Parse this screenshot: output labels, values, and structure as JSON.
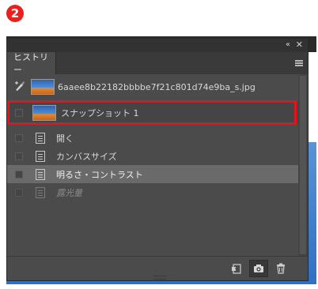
{
  "step_badge": "2",
  "panel": {
    "tab_label": "ヒストリー",
    "title_icons": {
      "collapse": "collapse-arrows-icon",
      "close": "close-icon",
      "menu": "panel-menu-icon"
    }
  },
  "history": {
    "source_image": "6aaee8b22182bbbbe7f21c801d74e9ba_s.jpg",
    "snapshot_label": "スナップショット 1",
    "states": [
      {
        "label": "開く",
        "state": "normal"
      },
      {
        "label": "カンバスサイズ",
        "state": "normal"
      },
      {
        "label": "明るさ・コントラスト",
        "state": "selected"
      },
      {
        "label": "露光量",
        "state": "disabled"
      }
    ]
  },
  "footer": {
    "new_document_icon": "new-document-from-state-icon",
    "camera_icon": "create-snapshot-camera-icon",
    "trash_icon": "delete-state-trash-icon"
  },
  "colors": {
    "panel_bg": "#4b4b4b",
    "selected_row": "#6a6a6a",
    "highlight": "#e3141b",
    "badge": "#e8201e"
  }
}
